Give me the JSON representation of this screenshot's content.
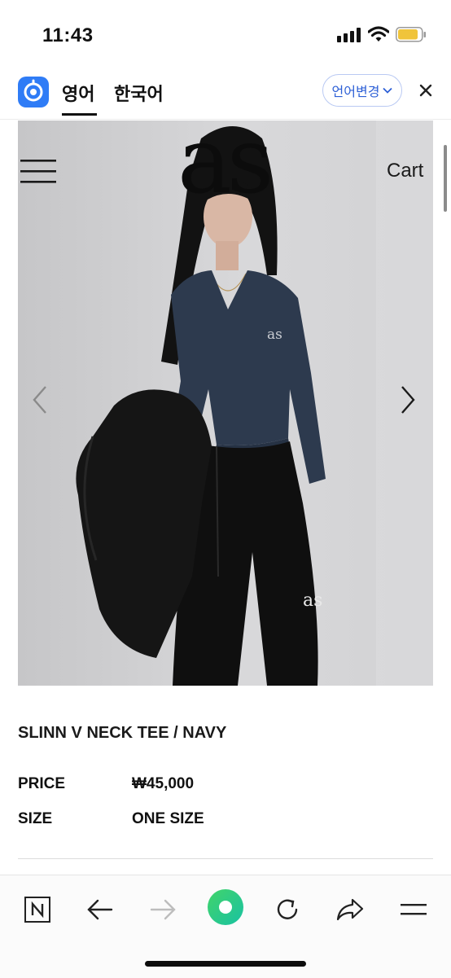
{
  "status": {
    "time": "11:43"
  },
  "translate_bar": {
    "tab_active": "영어",
    "tab_other": "한국어",
    "change_button": "언어변경",
    "accent_color": "#2f7cf6"
  },
  "header": {
    "brand": "as",
    "cart": "Cart"
  },
  "product": {
    "name": "SLINN V NECK TEE / NAVY",
    "price_label": "PRICE",
    "price_value": "₩45,000",
    "size_label": "SIZE",
    "size_value": "ONE SIZE",
    "shirt_logo": "as",
    "pants_logo": "as"
  },
  "toolbar": {
    "icons": [
      "naver-home-icon",
      "back-arrow-icon",
      "forward-arrow-icon",
      "green-dot-icon",
      "refresh-icon",
      "share-icon",
      "menu-icon"
    ]
  }
}
